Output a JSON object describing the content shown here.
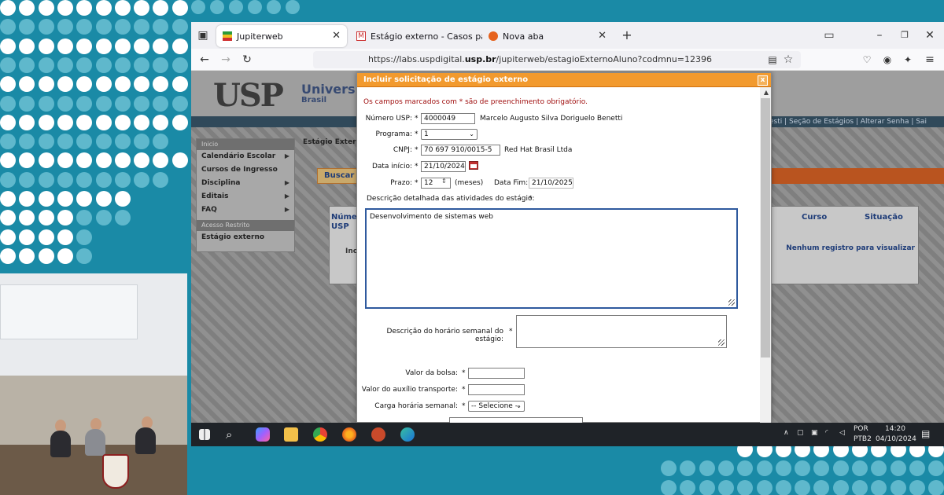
{
  "browser": {
    "tabs": [
      {
        "label": "Jupiterweb",
        "active": true
      },
      {
        "label": "Estágio externo - Casos para Te",
        "active": false
      },
      {
        "label": "Nova aba",
        "active": false
      }
    ],
    "new_tab_glyph": "+",
    "url_prefix": "https://labs.uspdigital.",
    "url_domain": "usp.br",
    "url_path": "/jupiterweb/estagioExternoAluno?codmnu=12396"
  },
  "page": {
    "logo": "USP",
    "title": "Universid",
    "subtitle": "Brasil",
    "top_links": "esti  |  Seção de Estágios  |  Alterar Senha  |  Sai",
    "left_menu": {
      "heading": "Inicio",
      "items": [
        "Calendário Escolar",
        "Cursos de Ingresso",
        "Disciplina",
        "Editais",
        "FAQ"
      ],
      "restricted_heading": "Acesso Restrito",
      "restricted_items": [
        "Estágio externo"
      ]
    },
    "breadcrumb": "Estágio Externo",
    "buscar_label": "Buscar",
    "table": {
      "col_numero": "Númer",
      "col_usp": "USP",
      "col_curso": "Curso",
      "col_situacao": "Situação",
      "empty_text": "Nenhum registro para visualizar",
      "add_link": "Inc"
    }
  },
  "modal": {
    "title": "Incluir solicitação de estágio externo",
    "close": "x",
    "required_note": "Os campos marcados com * são de preenchimento obrigatório.",
    "fields": {
      "numero_usp_label": "Número USP:",
      "numero_usp_value": "4000049",
      "student_name": "Marcelo Augusto Silva Doriguelo Benetti",
      "programa_label": "Programa:",
      "programa_value": "1",
      "cnpj_label": "CNPJ:",
      "cnpj_value": "70 697 910/0015-5",
      "company_name": "Red Hat Brasil Ltda",
      "data_inicio_label": "Data início:",
      "data_inicio_value": "21/10/2024",
      "prazo_label": "Prazo:",
      "prazo_value": "12",
      "prazo_unit": "(meses)",
      "data_fim_label": "Data Fim:",
      "data_fim_value": "21/10/2025",
      "descricao_label": "Descrição detalhada das atividades do estágio:",
      "descricao_value": "Desenvolvimento de sistemas web",
      "horario_label": "Descrição do horário semanal do estágio:",
      "horario_value": "",
      "bolsa_label": "Valor da bolsa:",
      "auxilio_label": "Valor do auxílio transporte:",
      "carga_label": "Carga horária semanal:",
      "carga_value": "-- Selecione --",
      "required_marker": "*"
    }
  },
  "taskbar": {
    "lang_line1": "POR",
    "lang_line2": "PTB2",
    "time": "14:20",
    "date": "04/10/2024"
  },
  "colors": {
    "background": "#1a8aa6",
    "modal_header": "#f29a2e",
    "required_text": "#a01010"
  }
}
